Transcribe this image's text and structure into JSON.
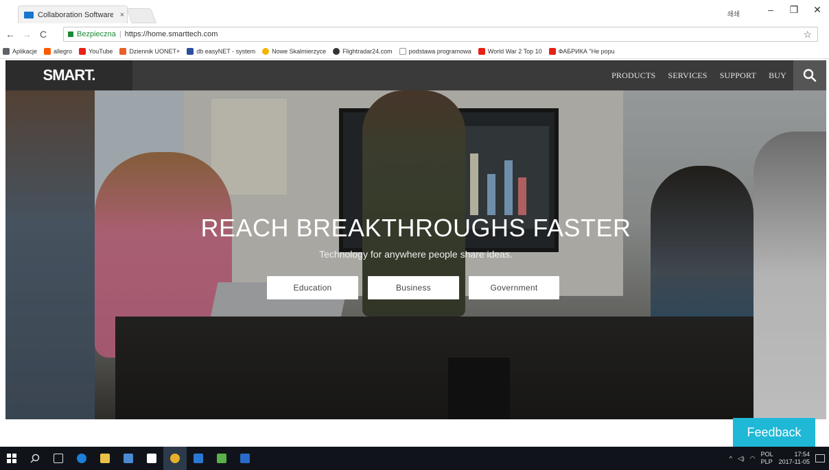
{
  "browser": {
    "tab_title": "Collaboration Software | SMART",
    "tab_close": "×",
    "user_label": "쇄쇄",
    "window_controls": [
      "–",
      "❐",
      "✕"
    ],
    "nav_buttons": [
      "←",
      "→",
      "C"
    ],
    "secure_label": "Bezpieczna",
    "separator": "|",
    "url": "https://home.smarttech.com",
    "star": "☆",
    "menu": "⋮"
  },
  "bookmarks": [
    {
      "label": "Aplikacje",
      "color": "#5f6368"
    },
    {
      "label": "allegro",
      "color": "#ff5a00"
    },
    {
      "label": "YouTube",
      "color": "#e62117"
    },
    {
      "label": "Dziennik UONET+",
      "color": "#e8602c"
    },
    {
      "label": "db easyNET - system",
      "color": "#2a4ea0"
    },
    {
      "label": "Nowe Skalmierzyce",
      "color": "#f5b400"
    },
    {
      "label": "Flightradar24.com",
      "color": "#333333"
    },
    {
      "label": "podstawa programowa",
      "color": "#999999"
    },
    {
      "label": "World War 2 Top 10",
      "color": "#e62117"
    },
    {
      "label": "ФАБРИКА \"Не popu",
      "color": "#e62117"
    }
  ],
  "site": {
    "logo": "SMART.",
    "nav": [
      "PRODUCTS",
      "SERVICES",
      "SUPPORT",
      "BUY"
    ],
    "headline": "REACH BREAKTHROUGHS FASTER",
    "subline": "Technology for anywhere people share ideas.",
    "cta": [
      "Education",
      "Business",
      "Government"
    ],
    "feedback": "Feedback"
  },
  "taskbar": {
    "lang_top": "POL",
    "lang_bottom": "PLP",
    "time": "17:54",
    "date": "2017-11-05"
  },
  "colors": {
    "header_bg": "#3a3a3a",
    "feedback_bg": "#1fb8d6"
  }
}
